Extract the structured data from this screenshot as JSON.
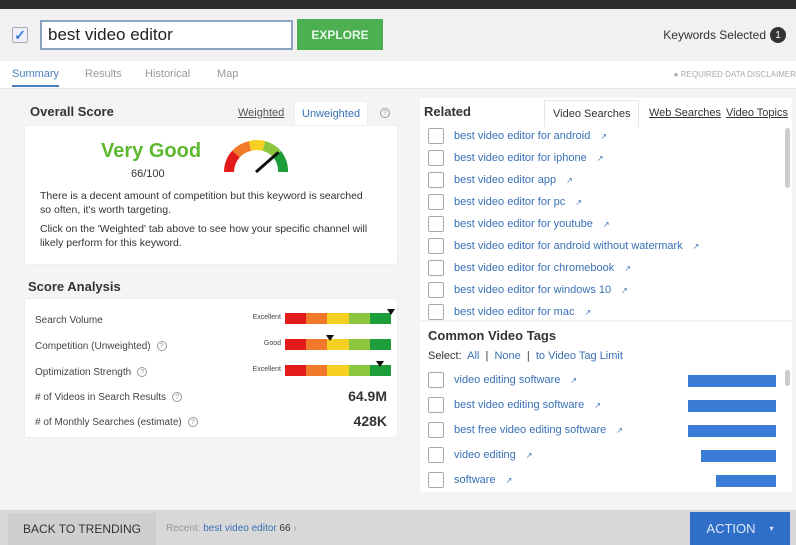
{
  "header": {
    "keyword": "best video editor",
    "explore_label": "EXPLORE",
    "keywords_selected_label": "Keywords Selected",
    "keywords_selected_count": "1"
  },
  "tabs": [
    "Summary",
    "Results",
    "Historical",
    "Map"
  ],
  "disclaimer": "REQUIRED DATA DISCLAIMER",
  "overall": {
    "title": "Overall Score",
    "weighted": "Weighted",
    "unweighted": "Unweighted",
    "rating": "Very Good",
    "score": "66/100",
    "score_value": 66,
    "rating_color": "#5cb82e",
    "desc1": "There is a decent amount of competition but this keyword is searched so often, it's worth targeting.",
    "desc2": "Click on the 'Weighted' tab above to see how your specific channel will likely perform for this keyword."
  },
  "analysis": {
    "title": "Score Analysis",
    "rows": [
      {
        "label": "Search Volume",
        "rating": "Excellent",
        "level": 1.0
      },
      {
        "label": "Competition (Unweighted)",
        "rating": "Good",
        "level": 0.42
      },
      {
        "label": "Optimization Strength",
        "rating": "Excellent",
        "level": 0.9
      }
    ],
    "videos_label": "# of Videos in Search Results",
    "videos_value": "64.9M",
    "searches_label": "# of Monthly Searches (estimate)",
    "searches_value": "428K"
  },
  "related": {
    "title": "Related",
    "tabs": [
      "Video Searches",
      "Web Searches",
      "Video Topics"
    ],
    "items": [
      "best video editor for android",
      "best video editor for iphone",
      "best video editor app",
      "best video editor for pc",
      "best video editor for youtube",
      "best video editor for android without watermark",
      "best video editor for chromebook",
      "best video editor for windows 10",
      "best video editor for mac"
    ]
  },
  "tags": {
    "title": "Common Video Tags",
    "select_label": "Select:",
    "all": "All",
    "none": "None",
    "limit": "to Video Tag Limit",
    "items": [
      {
        "label": "video editing software",
        "share": 1.0
      },
      {
        "label": "best video editing software",
        "share": 1.0
      },
      {
        "label": "best free video editing software",
        "share": 1.0
      },
      {
        "label": "video editing",
        "share": 0.85
      },
      {
        "label": "software",
        "share": 0.68
      }
    ]
  },
  "footer": {
    "back": "BACK TO TRENDING",
    "recent_label": "Recent:",
    "recent_keyword": "best video editor",
    "recent_score": "66",
    "action": "ACTION"
  }
}
